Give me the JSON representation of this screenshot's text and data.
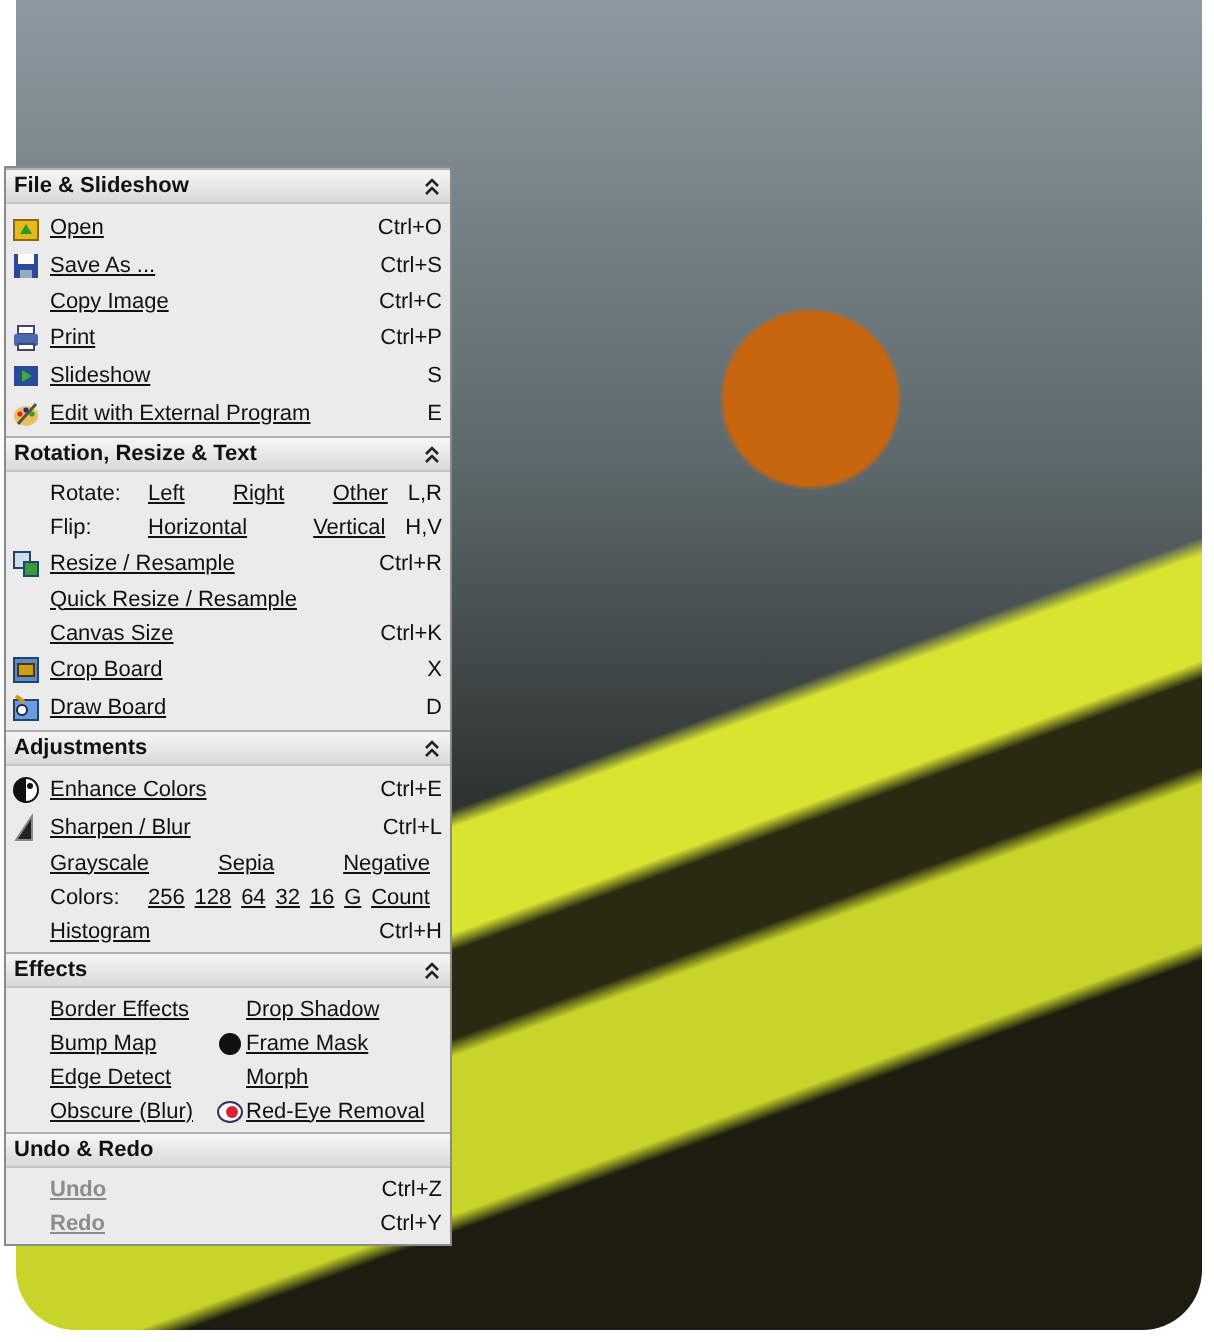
{
  "sections": [
    {
      "title": "File & Slideshow",
      "collapsible": true,
      "rows": [
        {
          "kind": "command",
          "icon": true,
          "label": "Open",
          "shortcut": "Ctrl+O",
          "disabled": false
        },
        {
          "kind": "command",
          "icon": true,
          "label": "Save As ...",
          "shortcut": "Ctrl+S",
          "disabled": false
        },
        {
          "kind": "command",
          "icon": false,
          "label": "Copy Image",
          "shortcut": "Ctrl+C",
          "disabled": false
        },
        {
          "kind": "command",
          "icon": true,
          "label": "Print",
          "shortcut": "Ctrl+P",
          "disabled": false
        },
        {
          "kind": "command",
          "icon": true,
          "label": "Slideshow",
          "shortcut": "S",
          "disabled": false
        },
        {
          "kind": "command",
          "icon": true,
          "label": "Edit with External Program",
          "shortcut": "E",
          "disabled": false
        }
      ]
    },
    {
      "title": "Rotation, Resize & Text",
      "collapsible": true,
      "rows": [
        {
          "kind": "links",
          "label": "Rotate:",
          "links": [
            "Left",
            "Right",
            "Other"
          ],
          "shortcut": "L,R"
        },
        {
          "kind": "links",
          "label": "Flip:",
          "links": [
            "Horizontal",
            "Vertical"
          ],
          "shortcut": "H,V"
        },
        {
          "kind": "command",
          "icon": true,
          "label": "Resize / Resample",
          "shortcut": "Ctrl+R",
          "disabled": false
        },
        {
          "kind": "command",
          "icon": false,
          "label": "Quick Resize / Resample",
          "disabled": false
        },
        {
          "kind": "command",
          "icon": false,
          "label": "Canvas Size",
          "shortcut": "Ctrl+K",
          "disabled": false
        },
        {
          "kind": "command",
          "icon": true,
          "label": "Crop Board",
          "shortcut": "X",
          "disabled": false
        },
        {
          "kind": "command",
          "icon": true,
          "label": "Draw Board",
          "shortcut": "D",
          "disabled": false
        }
      ]
    },
    {
      "title": "Adjustments",
      "collapsible": true,
      "rows": [
        {
          "kind": "command",
          "icon": true,
          "label": "Enhance Colors",
          "shortcut": "Ctrl+E",
          "disabled": false
        },
        {
          "kind": "command",
          "icon": true,
          "label": "Sharpen / Blur",
          "shortcut": "Ctrl+L",
          "disabled": false
        },
        {
          "kind": "links",
          "links": [
            "Grayscale",
            "Sepia",
            "Negative"
          ]
        },
        {
          "kind": "links",
          "label": "Colors:",
          "links": [
            "256",
            "128",
            "64",
            "32",
            "16",
            "G",
            "Count"
          ]
        },
        {
          "kind": "command",
          "icon": false,
          "label": "Histogram",
          "shortcut": "Ctrl+H",
          "disabled": false
        }
      ]
    },
    {
      "title": "Effects",
      "collapsible": true,
      "rows": [
        {
          "kind": "grid",
          "items": [
            {
              "label": "Border Effects",
              "icon": false
            },
            {
              "label": "Drop Shadow",
              "icon": false
            },
            {
              "label": "Bump Map",
              "icon": false
            },
            {
              "label": "Frame Mask",
              "icon": true
            },
            {
              "label": "Edge Detect",
              "icon": false
            },
            {
              "label": "Morph",
              "icon": false
            },
            {
              "label": "Obscure (Blur)",
              "icon": false
            },
            {
              "label": "Red-Eye Removal",
              "icon": true
            }
          ]
        }
      ]
    },
    {
      "title": "Undo & Redo",
      "collapsible": false,
      "rows": [
        {
          "kind": "command",
          "icon": false,
          "label": "Undo",
          "shortcut": "Ctrl+Z",
          "disabled": true
        },
        {
          "kind": "command",
          "icon": false,
          "label": "Redo",
          "shortcut": "Ctrl+Y",
          "disabled": true
        }
      ]
    }
  ]
}
